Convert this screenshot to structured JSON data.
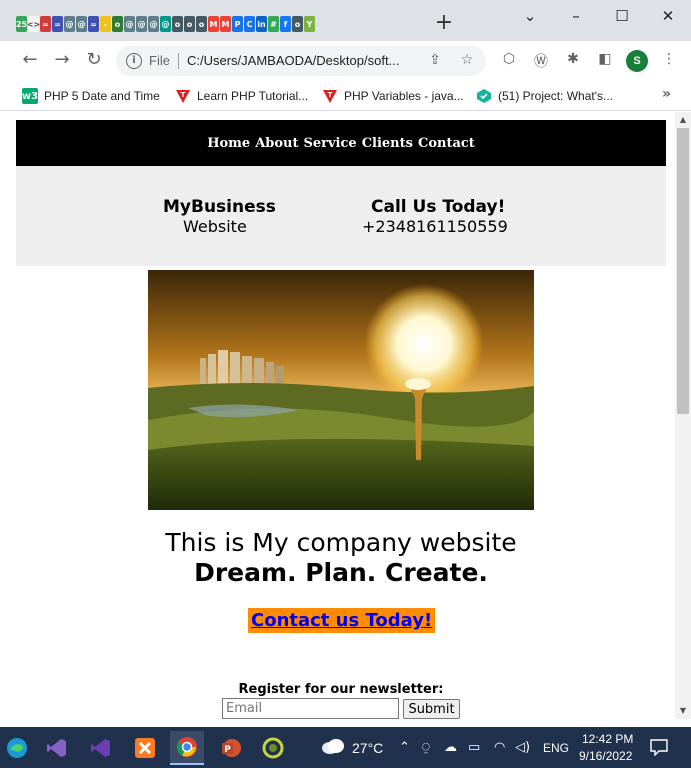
{
  "browser": {
    "omnibox": {
      "scheme_label": "File",
      "url": "C:/Users/JAMBAODA/Desktop/soft..."
    },
    "tab_favicons": [
      {
        "icon": "phpdate-icon",
        "color": "#3aa55a",
        "label": "25"
      },
      {
        "icon": "code-icon",
        "color": "#f4f4f4",
        "label": "<>"
      },
      {
        "icon": "grid-icon",
        "color": "#d23b3b",
        "label": "="
      },
      {
        "icon": "list-icon",
        "color": "#3f51b5",
        "label": "="
      },
      {
        "icon": "circle-icon",
        "color": "#607d8b",
        "label": "@"
      },
      {
        "icon": "circle-icon",
        "color": "#607d8b",
        "label": "@"
      },
      {
        "icon": "list-icon",
        "color": "#3f51b5",
        "label": "="
      },
      {
        "icon": "rect-icon",
        "color": "#f0c21d",
        "label": "-"
      },
      {
        "icon": "battery-icon",
        "color": "#2e7d32",
        "label": "o"
      },
      {
        "icon": "circle-icon",
        "color": "#607d8b",
        "label": "@"
      },
      {
        "icon": "circle-icon",
        "color": "#607d8b",
        "label": "@"
      },
      {
        "icon": "circle-icon",
        "color": "#607d8b",
        "label": "@"
      },
      {
        "icon": "circle-icon",
        "color": "#009688",
        "label": "@"
      },
      {
        "icon": "face-icon",
        "color": "#455a64",
        "label": "o"
      },
      {
        "icon": "face-icon",
        "color": "#455a64",
        "label": "o"
      },
      {
        "icon": "face-icon",
        "color": "#455a64",
        "label": "o"
      },
      {
        "icon": "gmail-icon",
        "color": "#ea4335",
        "label": "M"
      },
      {
        "icon": "gmail-icon",
        "color": "#ea4335",
        "label": "M"
      },
      {
        "icon": "doc-icon",
        "color": "#1a73e8",
        "label": "P"
      },
      {
        "icon": "doc-icon",
        "color": "#1a73e8",
        "label": "C"
      },
      {
        "icon": "linkedin-icon",
        "color": "#0a66c2",
        "label": "in"
      },
      {
        "icon": "green-icon",
        "color": "#34a853",
        "label": "#"
      },
      {
        "icon": "facebook-icon",
        "color": "#1877f2",
        "label": "f"
      },
      {
        "icon": "circle-icon",
        "color": "#455a64",
        "label": "o"
      },
      {
        "icon": "y-icon",
        "color": "#7cb342",
        "label": "Y"
      }
    ],
    "bookmarks": [
      {
        "label": "PHP 5 Date and Time",
        "icon": "w3schools-icon",
        "color": "#04aa6d",
        "glyph": "w3"
      },
      {
        "label": "Learn PHP Tutorial...",
        "icon": "tutorial-t-icon",
        "color": "#e21b1b",
        "glyph": "T"
      },
      {
        "label": "PHP Variables - java...",
        "icon": "tutorial-t-icon",
        "color": "#e21b1b",
        "glyph": "T"
      },
      {
        "label": "(51) Project: What's...",
        "icon": "hexagon-icon",
        "color": "#10b59c",
        "glyph": "◆"
      }
    ]
  },
  "site": {
    "nav": [
      "Home",
      "About",
      "Service",
      "Clients",
      "Contact"
    ],
    "brand_name": "MyBusiness",
    "brand_sub": "Website",
    "call_title": "Call Us Today!",
    "call_phone": "+2348161150559",
    "tagline": "This is My company website",
    "slogan": "Dream. Plan. Create.",
    "cta": "Contact us Today!",
    "newsletter_label": "Register for our newsletter:",
    "email_placeholder": "Email",
    "submit_label": "Submit"
  },
  "taskbar": {
    "weather": "27°C",
    "language": "ENG",
    "time": "12:42 PM",
    "date": "9/16/2022"
  }
}
